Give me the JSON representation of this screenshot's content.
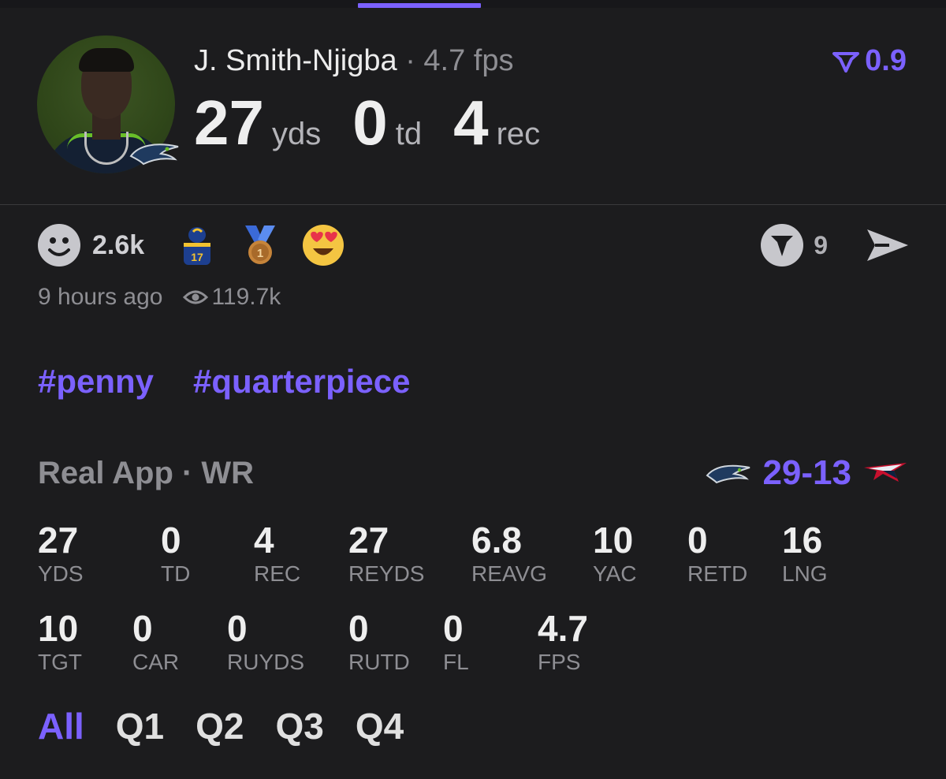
{
  "player": {
    "name": "J. Smith-Njigba",
    "separator": "·",
    "fps": "4.7 fps",
    "rating": "0.9"
  },
  "headline_stats": [
    {
      "value": "27",
      "unit": "yds"
    },
    {
      "value": "0",
      "unit": "td"
    },
    {
      "value": "4",
      "unit": "rec"
    }
  ],
  "reactions": {
    "count": "2.6k",
    "icons": [
      "smiley-face-icon",
      "player-sticker-icon",
      "bronze-medal-icon",
      "heart-eyes-emoji-icon"
    ]
  },
  "actions": {
    "comment_count": "9",
    "share_icon": "send-arrow-icon"
  },
  "meta": {
    "time_ago": "9 hours ago",
    "views": "119.7k"
  },
  "tags": [
    "#penny",
    "#quarterpiece"
  ],
  "game": {
    "source": "Real App · WR",
    "score": "29-13",
    "home_team_logo": "seahawks-logo-icon",
    "away_team_logo": "patriots-logo-icon"
  },
  "stats_row1": [
    {
      "value": "27",
      "label": "YDS"
    },
    {
      "value": "0",
      "label": "TD"
    },
    {
      "value": "4",
      "label": "REC"
    },
    {
      "value": "27",
      "label": "REYDS"
    },
    {
      "value": "6.8",
      "label": "REAVG"
    },
    {
      "value": "10",
      "label": "YAC"
    },
    {
      "value": "0",
      "label": "RETD"
    },
    {
      "value": "16",
      "label": "LNG"
    }
  ],
  "stats_row2": [
    {
      "value": "10",
      "label": "TGT"
    },
    {
      "value": "0",
      "label": "CAR"
    },
    {
      "value": "0",
      "label": "RUYDS"
    },
    {
      "value": "0",
      "label": "RUTD"
    },
    {
      "value": "0",
      "label": "FL"
    },
    {
      "value": "4.7",
      "label": "FPS"
    }
  ],
  "quarters": {
    "tabs": [
      "All",
      "Q1",
      "Q2",
      "Q3",
      "Q4"
    ],
    "active": "All"
  },
  "colors": {
    "accent": "#7b61ff",
    "background": "#1c1c1e",
    "muted": "#8e8e93"
  }
}
